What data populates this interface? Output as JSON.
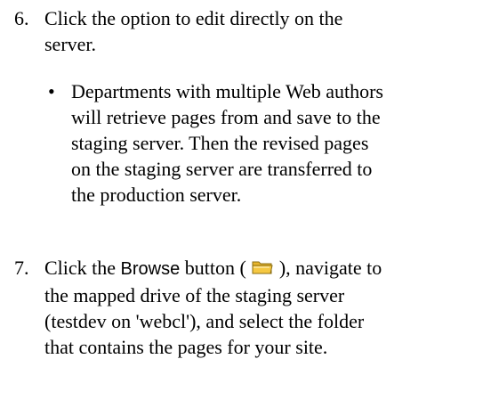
{
  "step6": {
    "number": "6.",
    "line1": "Click the option to edit directly on the",
    "line2": "server."
  },
  "bullet": {
    "symbol": "•",
    "line1": "Departments with multiple Web authors",
    "line2": "will retrieve pages from and save to the",
    "line3": "staging server.  Then the revised pages",
    "line4": "on the staging server are transferred to",
    "line5": "the production server."
  },
  "step7": {
    "number": "7.",
    "line1_prefix": "Click the ",
    "line1_button": "Browse",
    "line1_mid": " button ( ",
    "line1_icon": "folder-icon",
    "line1_suffix": " ), navigate to",
    "line2": "the mapped drive of the staging server",
    "line3": "(testdev on 'webcl'), and select the folder",
    "line4": "that contains the pages for your site."
  },
  "colors": {
    "text": "#000000",
    "folder_fill": "#f5c842",
    "folder_stroke": "#8a6d12"
  }
}
